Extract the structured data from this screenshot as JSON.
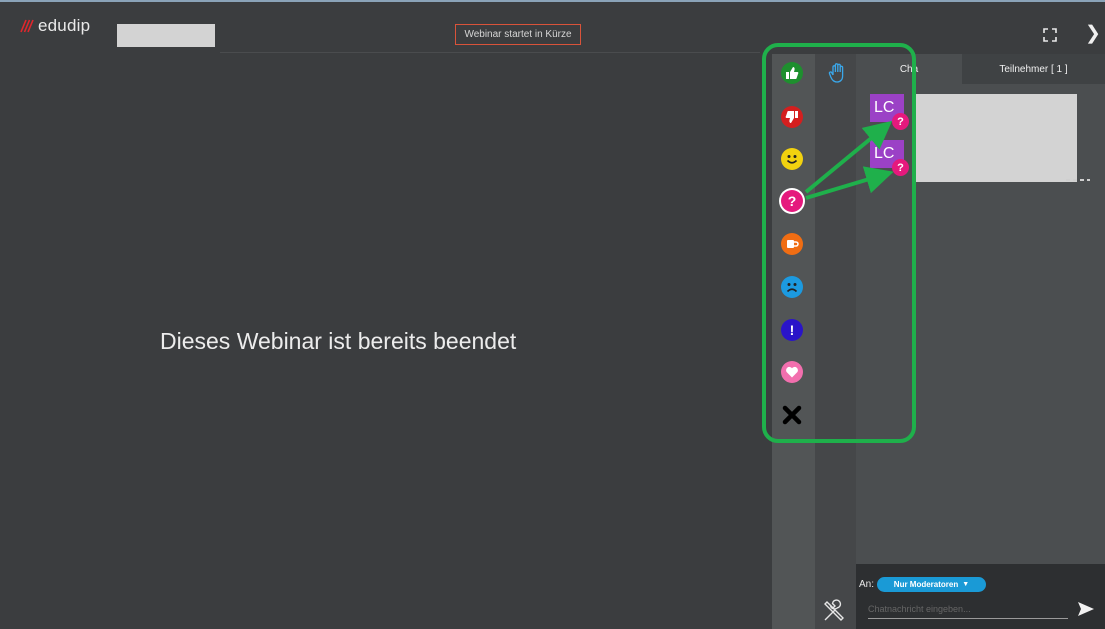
{
  "header": {
    "brand": "edudip",
    "status_text": "Webinar startet in Kürze"
  },
  "main": {
    "message": "Dieses Webinar ist bereits beendet"
  },
  "reactions": [
    {
      "name": "thumbs-up",
      "color": "#1e8f2e"
    },
    {
      "name": "thumbs-down",
      "color": "#d41f1f"
    },
    {
      "name": "smile",
      "color": "#f2d20f"
    },
    {
      "name": "question",
      "color": "#e5197d",
      "glyph": "?"
    },
    {
      "name": "coffee",
      "color": "#f06d13"
    },
    {
      "name": "sad",
      "color": "#1c9ae0"
    },
    {
      "name": "exclamation",
      "color": "#2a14c9",
      "glyph": "!"
    },
    {
      "name": "heart",
      "color": "#f26fae"
    },
    {
      "name": "close",
      "color": "#000000"
    }
  ],
  "chat": {
    "tab_chat": "Cha",
    "tab_participants": "Teilnehmer [ 1 ]",
    "messages": [
      {
        "initials": "LC",
        "badge": "?"
      },
      {
        "initials": "LC",
        "badge": "?"
      }
    ],
    "to_label": "An:",
    "recipient": "Nur Moderatoren",
    "input_placeholder": "Chatnachricht eingeben..."
  },
  "colors": {
    "background": "#3b3d3f",
    "highlight": "#1fb04b",
    "avatar": "#9b41c6",
    "badge": "#e5197d",
    "recipient_pill": "#1a9ad6",
    "brand_accent": "#e2262c"
  }
}
